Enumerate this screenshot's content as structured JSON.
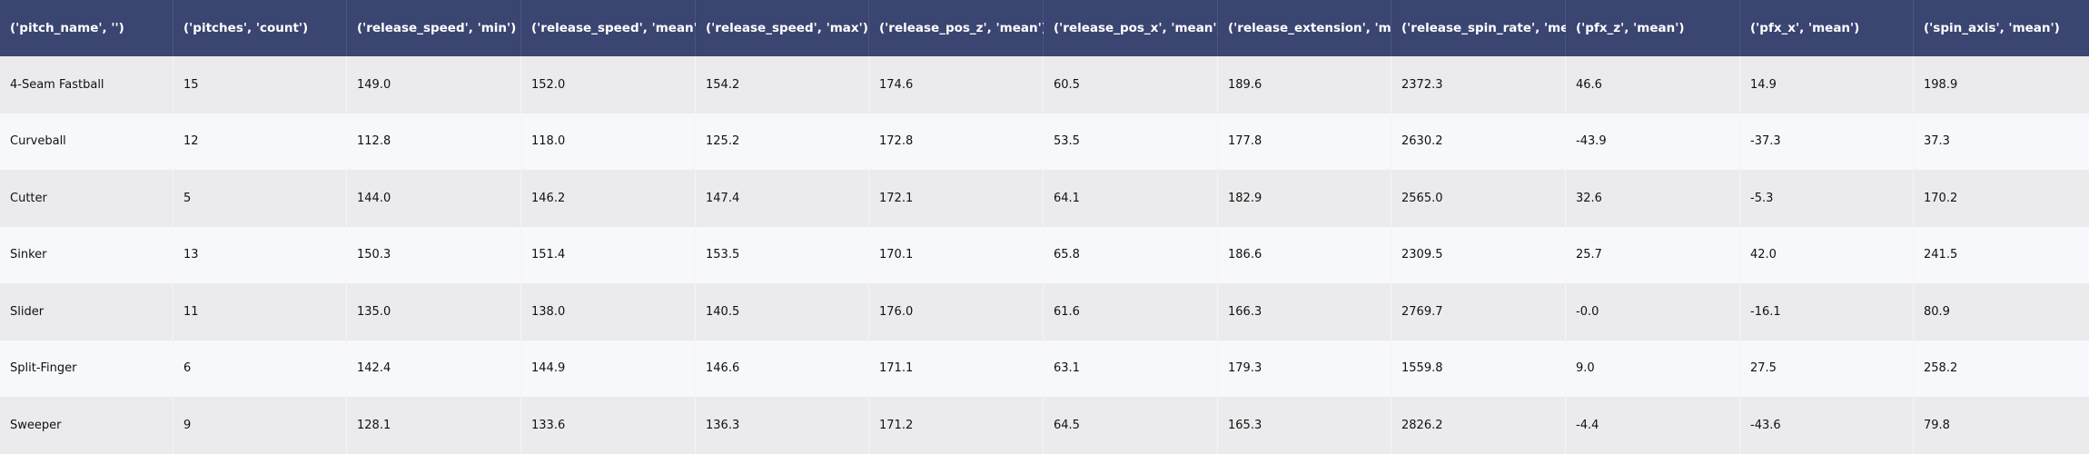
{
  "table": {
    "headers": [
      "('pitch_name', '')",
      "('pitches', 'count')",
      "('release_speed', 'min')",
      "('release_speed', 'mean')",
      "('release_speed', 'max')",
      "('release_pos_z', 'mean')",
      "('release_pos_x', 'mean')",
      "('release_extension', 'mean')",
      "('release_spin_rate', 'mean')",
      "('pfx_z', 'mean')",
      "('pfx_x', 'mean')",
      "('spin_axis', 'mean')"
    ],
    "rows": [
      [
        "4-Seam Fastball",
        "15",
        "149.0",
        "152.0",
        "154.2",
        "174.6",
        "60.5",
        "189.6",
        "2372.3",
        "46.6",
        "14.9",
        "198.9"
      ],
      [
        "Curveball",
        "12",
        "112.8",
        "118.0",
        "125.2",
        "172.8",
        "53.5",
        "177.8",
        "2630.2",
        "-43.9",
        "-37.3",
        "37.3"
      ],
      [
        "Cutter",
        "5",
        "144.0",
        "146.2",
        "147.4",
        "172.1",
        "64.1",
        "182.9",
        "2565.0",
        "32.6",
        "-5.3",
        "170.2"
      ],
      [
        "Sinker",
        "13",
        "150.3",
        "151.4",
        "153.5",
        "170.1",
        "65.8",
        "186.6",
        "2309.5",
        "25.7",
        "42.0",
        "241.5"
      ],
      [
        "Slider",
        "11",
        "135.0",
        "138.0",
        "140.5",
        "176.0",
        "61.6",
        "166.3",
        "2769.7",
        "-0.0",
        "-16.1",
        "80.9"
      ],
      [
        "Split-Finger",
        "6",
        "142.4",
        "144.9",
        "146.6",
        "171.1",
        "63.1",
        "179.3",
        "1559.8",
        "9.0",
        "27.5",
        "258.2"
      ],
      [
        "Sweeper",
        "9",
        "128.1",
        "133.6",
        "136.3",
        "171.2",
        "64.5",
        "165.3",
        "2826.2",
        "-4.4",
        "-43.6",
        "79.8"
      ]
    ]
  },
  "colors": {
    "header_bg": "#3b4571",
    "header_text": "#ffffff",
    "row_odd_bg": "#ebebed",
    "row_even_bg": "#f7f8fc",
    "body_text": "#111111"
  }
}
